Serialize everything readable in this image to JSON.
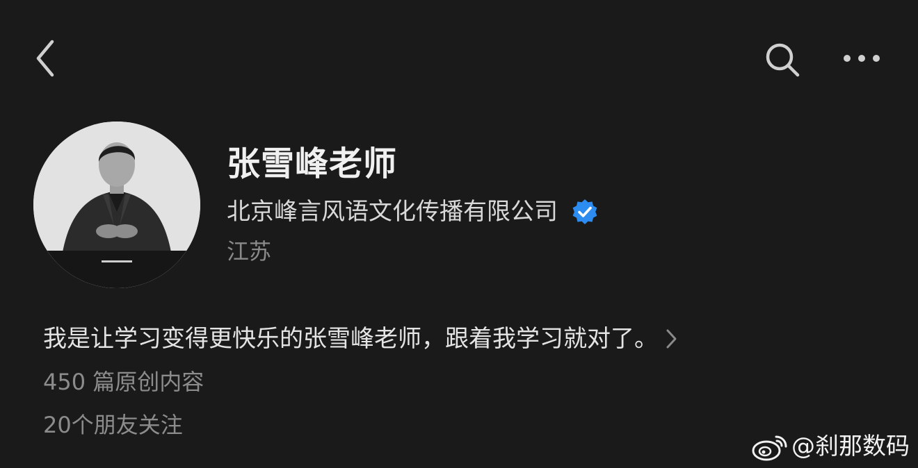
{
  "topbar": {
    "back_icon": "chevron-left-icon",
    "search_icon": "search-icon",
    "more_icon": "more-horizontal-icon"
  },
  "profile": {
    "name": "张雪峰老师",
    "organization": "北京峰言风语文化传播有限公司",
    "verified_icon": "verified-badge-icon",
    "verified_color": "#2d8cf0",
    "location": "江苏",
    "avatar_description": "avatar-photo"
  },
  "bio": {
    "text": "我是让学习变得更快乐的张雪峰老师，跟着我学习就对了。",
    "arrow_icon": "chevron-right-icon"
  },
  "stats": {
    "articles": "450 篇原创内容",
    "friends_following": "20个朋友关注"
  },
  "watermark": {
    "logo_icon": "weibo-logo-icon",
    "text": "@刹那数码"
  },
  "colors": {
    "background": "#1a1a1a",
    "primary_text": "#f0f0f0",
    "secondary_text": "#8a8a8a",
    "accent": "#2d8cf0"
  }
}
